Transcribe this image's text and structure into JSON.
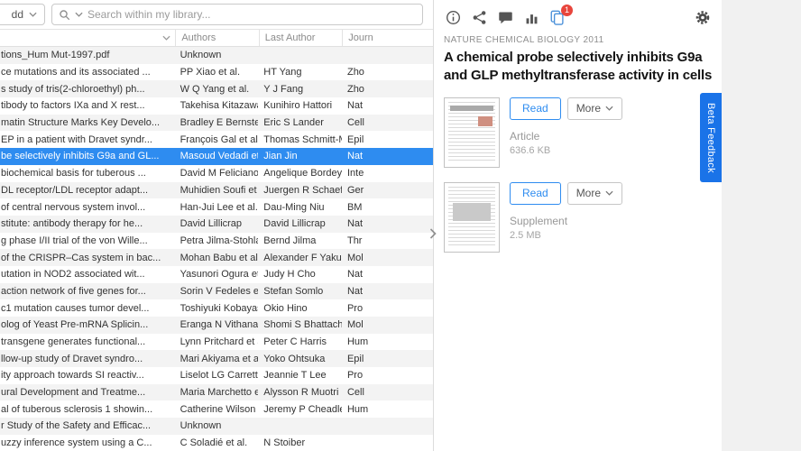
{
  "toolbar": {
    "add_label": "dd",
    "search_placeholder": "Search within my library..."
  },
  "table": {
    "columns": {
      "authors": "Authors",
      "last_author": "Last Author",
      "journal": "Journ"
    },
    "selected_index": 6,
    "rows": [
      {
        "title": "tions_Hum Mut-1997.pdf",
        "authors": "Unknown",
        "last_author": "",
        "journal": ""
      },
      {
        "title": "ce mutations and its associated ...",
        "authors": "PP Xiao et al.",
        "last_author": "HT Yang",
        "journal": "Zho"
      },
      {
        "title": "s study of tris(2-chloroethyl) ph...",
        "authors": "W Q Yang et al.",
        "last_author": "Y J Fang",
        "journal": "Zho"
      },
      {
        "title": "tibody to factors IXa and X rest...",
        "authors": "Takehisa Kitazawa et ...",
        "last_author": "Kunihiro Hattori",
        "journal": "Nat"
      },
      {
        "title": "matin Structure Marks Key Develo...",
        "authors": "Bradley E Bernstein et ...",
        "last_author": "Eric S Lander",
        "journal": "Cell"
      },
      {
        "title": "EP in a patient with Dravet syndr...",
        "authors": "François Gal et al.",
        "last_author": "Thomas Schmitt-Mec...",
        "journal": "Epil"
      },
      {
        "title": "be selectively inhibits G9a and GL...",
        "authors": "Masoud Vedadi et al.",
        "last_author": "Jian Jin",
        "journal": "Nat"
      },
      {
        "title": "biochemical basis for tuberous ...",
        "authors": "David M Feliciano et al.",
        "last_author": "Angelique Bordey",
        "journal": "Inte"
      },
      {
        "title": "DL receptor/LDL receptor adapt...",
        "authors": "Muhidien Soufi et al.",
        "last_author": "Juergen R Schaefer",
        "journal": "Ger"
      },
      {
        "title": "of central nervous system invol...",
        "authors": "Han-Jui Lee et al.",
        "last_author": "Dau-Ming Niu",
        "journal": "BM"
      },
      {
        "title": "stitute: antibody therapy for he...",
        "authors": "David Lillicrap",
        "last_author": "David Lillicrap",
        "journal": "Nat"
      },
      {
        "title": "g phase I/II trial of the von Wille...",
        "authors": "Petra Jilma-Stohlawe...",
        "last_author": "Bernd Jilma",
        "journal": "Thr"
      },
      {
        "title": "of the CRISPR–Cas system in bac...",
        "authors": "Mohan Babu et al.",
        "last_author": "Alexander F Yakunin",
        "journal": "Mol"
      },
      {
        "title": "utation in NOD2 associated wit...",
        "authors": "Yasunori Ogura et al.",
        "last_author": "Judy H Cho",
        "journal": "Nat"
      },
      {
        "title": "action network of five genes for...",
        "authors": "Sorin V Fedeles et al.",
        "last_author": "Stefan Somlo",
        "journal": "Nat"
      },
      {
        "title": "c1 mutation causes tumor devel...",
        "authors": "Toshiyuki Kobayashi ...",
        "last_author": "Okio Hino",
        "journal": "Pro"
      },
      {
        "title": "olog of Yeast Pre-mRNA Splicin...",
        "authors": "Eranga N Vithana et al.",
        "last_author": "Shomi S Bhattacharya",
        "journal": "Mol"
      },
      {
        "title": "transgene generates functional...",
        "authors": "Lynn Pritchard et al.",
        "last_author": "Peter C Harris",
        "journal": "Hum"
      },
      {
        "title": "llow-up study of Dravet syndro...",
        "authors": "Mari Akiyama et al.",
        "last_author": "Yoko Ohtsuka",
        "journal": "Epil"
      },
      {
        "title": "ity approach towards SI reactiv...",
        "authors": "Liselot LG Carrette ...",
        "last_author": "Jeannie T Lee",
        "journal": "Pro"
      },
      {
        "title": "ural Development and Treatme...",
        "authors": "Maria Marchetto et al.",
        "last_author": "Alysson R Muotri",
        "journal": "Cell"
      },
      {
        "title": "al of tuberous sclerosis 1 showin...",
        "authors": "Catherine Wilson et al.",
        "last_author": "Jeremy P Cheadle",
        "journal": "Hum"
      },
      {
        "title": "r Study of the Safety and Efficac...",
        "authors": "Unknown",
        "last_author": "",
        "journal": ""
      },
      {
        "title": "uzzy inference system using a C...",
        "authors": "C Soladié et al.",
        "last_author": "N Stoiber",
        "journal": ""
      }
    ]
  },
  "detail": {
    "badge_count": "1",
    "journal_header": "NATURE CHEMICAL BIOLOGY 2011",
    "title": "A chemical probe selectively inhibits G9a and GLP methyltransferase activity in cells",
    "files": [
      {
        "read_label": "Read",
        "more_label": "More",
        "kind": "Article",
        "size": "636.6 KB"
      },
      {
        "read_label": "Read",
        "more_label": "More",
        "kind": "Supplement",
        "size": "2.5 MB"
      }
    ],
    "beta_tab": "Beta Feedback"
  },
  "icons": {
    "search-icon": "magnifier",
    "chevron-down-icon": "⌄",
    "sort-chevron-icon": "⌄",
    "info-icon": "ⓘ",
    "share-icon": "share-nodes",
    "comment-icon": "speech-bubble",
    "metrics-icon": "bar-chart",
    "library-sync-icon": "copy-stack",
    "settings-gear-icon": "⚙",
    "collapse-panel-icon": "❯"
  },
  "colors": {
    "accent": "#2e8cf0",
    "badge": "#e8453c",
    "beta": "#1a73e8"
  }
}
